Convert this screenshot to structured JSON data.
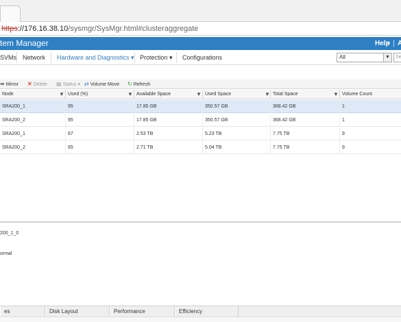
{
  "browser": {
    "url_scheme": "https",
    "url_sep": "://",
    "url_host": "176.16.38.10",
    "url_path": "/sysmgr/SysMgr.html#clusteraggregate"
  },
  "header": {
    "title": "tem Manager",
    "help_label": "Help",
    "help_caret": "▾",
    "separator": "|",
    "right_label": "A"
  },
  "nav": {
    "items": [
      {
        "label": "SVMs"
      },
      {
        "label": "Network"
      },
      {
        "label": "Hardware and Diagnostics ▾"
      },
      {
        "label": "Protection ▾"
      },
      {
        "label": "Configurations"
      }
    ],
    "active_index": 2,
    "scope_value": "All",
    "search_placeholder": "Sea"
  },
  "toolbar": {
    "mirror": "Mirror",
    "delete": "Delete",
    "status": "Status ▾",
    "volume_move": "Volume Move",
    "refresh": "Refresh"
  },
  "grid": {
    "columns": [
      "Node",
      "Used (%)",
      "Available Space",
      "Used Space",
      "Total Space",
      "Volume Count"
    ],
    "rows": [
      {
        "node": "SRA200_1",
        "used_pct": "95",
        "available": "17.85 GB",
        "used": "350.57 GB",
        "total": "368.42 GB",
        "vol_count": "1",
        "selected": true
      },
      {
        "node": "SRA200_2",
        "used_pct": "95",
        "available": "17.85 GB",
        "used": "350.57 GB",
        "total": "368.42 GB",
        "vol_count": "1",
        "selected": false
      },
      {
        "node": "SRA200_1",
        "used_pct": "67",
        "available": "2.53 TB",
        "used": "5.23 TB",
        "total": "7.75 TB",
        "vol_count": "9",
        "selected": false
      },
      {
        "node": "SRA200_2",
        "used_pct": "65",
        "available": "2.71 TB",
        "used": "5.04 TB",
        "total": "7.75 TB",
        "vol_count": "9",
        "selected": false
      }
    ]
  },
  "detail": {
    "line1": "200_1_0",
    "line2": "ormal"
  },
  "bottom_tabs": [
    "es",
    "Disk Layout",
    "Performance",
    "Efficiency"
  ],
  "colors": {
    "header_blue": "#2f7fc3",
    "selected_row": "#dde9f7",
    "delete_red": "#d24b3e",
    "refresh_green": "#3b9b3b"
  }
}
